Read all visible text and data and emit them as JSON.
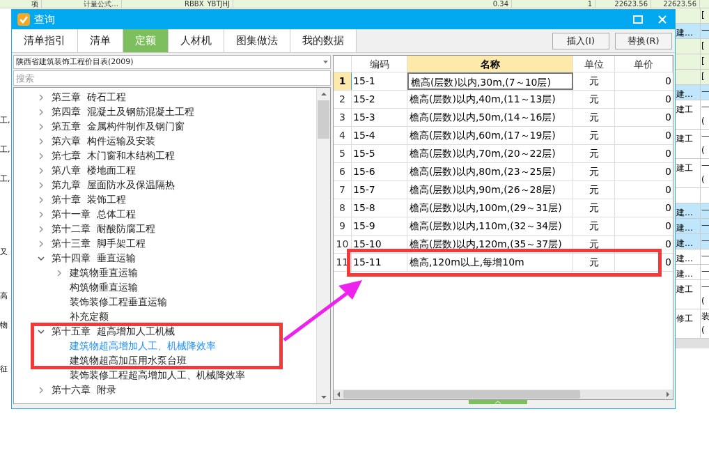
{
  "background": {
    "top_row": [
      "项",
      "计量公式…",
      "RBBX_YBTJHJ",
      "0.34",
      "1",
      "22623.56",
      "22623.56"
    ],
    "left_cells": [
      {},
      {},
      {},
      {},
      {},
      {},
      {},
      {
        "text": "工,"
      },
      {},
      {
        "text": "工,"
      },
      {},
      {
        "text": "工,"
      },
      {},
      {},
      {},
      {},
      {
        "text": "又"
      },
      {},
      {},
      {
        "text": "高"
      },
      {},
      {
        "text": "物"
      },
      {},
      {},
      {
        "text": "征"
      }
    ],
    "right_rows": [
      {
        "kind": "group",
        "column_2": [
          "["
        ]
      },
      {
        "kind": "item",
        "selected": true,
        "column_1": "建…",
        "column_2": [
          "一"
        ]
      },
      {
        "kind": "group",
        "column_2": [
          "["
        ]
      },
      {
        "kind": "group",
        "column_2": [
          "["
        ]
      },
      {
        "kind": "group",
        "column_2": [
          "["
        ]
      },
      {
        "kind": "item",
        "selected": true,
        "column_1": "建…",
        "column_2": [
          "一"
        ]
      },
      {
        "kind": "item",
        "selected": false,
        "column_1": "建工",
        "column_2": [
          "一",
          "("
        ]
      },
      {
        "kind": "item",
        "selected": false,
        "column_1": "建工",
        "column_2": [
          "一",
          "("
        ]
      },
      {
        "kind": "item",
        "selected": false,
        "column_1": "建工",
        "column_2": [
          "一",
          "("
        ]
      },
      {
        "kind": "item",
        "selected": false
      },
      {
        "kind": "item",
        "selected": true,
        "column_1": "建…",
        "column_2": [
          "一"
        ]
      },
      {
        "kind": "item",
        "selected": true,
        "column_1": "建…",
        "column_2": [
          "一"
        ]
      },
      {
        "kind": "item",
        "selected": true,
        "column_1": "建…",
        "column_2": [
          "一"
        ]
      },
      {
        "kind": "item",
        "selected": false,
        "column_1": "建…",
        "column_2": [
          "一"
        ]
      },
      {
        "kind": "item",
        "selected": false,
        "column_1": "建…",
        "column_2": [
          "一"
        ]
      },
      {
        "kind": "item",
        "selected": false,
        "column_1": "建工",
        "column_2": [
          "一",
          "("
        ]
      },
      {
        "kind": "item",
        "selected": false,
        "column_1": "修工",
        "column_2": [
          "装",
          "("
        ]
      }
    ]
  },
  "window": {
    "title": "查询"
  },
  "tabs": [
    {
      "label": "清单指引",
      "selected": false
    },
    {
      "label": "清单",
      "selected": false
    },
    {
      "label": "定额",
      "selected": true
    },
    {
      "label": "人材机",
      "selected": false
    },
    {
      "label": "图集做法",
      "selected": false
    },
    {
      "label": "我的数据",
      "selected": false
    }
  ],
  "buttons": [
    "插入(I)",
    "替换(R)"
  ],
  "library": {
    "value": "陕西省建筑装饰工程价目表(2009)"
  },
  "search": {
    "placeholder": "搜索"
  },
  "tree": [
    {
      "label": "第三章  砖石工程",
      "expanded": false
    },
    {
      "label": "第四章  混凝土及钢筋混凝土工程",
      "expanded": false
    },
    {
      "label": "第五章  金属构件制作及钢门窗",
      "expanded": false
    },
    {
      "label": "第六章  构件运输及安装",
      "expanded": false
    },
    {
      "label": "第七章  木门窗和木结构工程",
      "expanded": false
    },
    {
      "label": "第八章  楼地面工程",
      "expanded": false
    },
    {
      "label": "第九章  屋面防水及保温隔热",
      "expanded": false
    },
    {
      "label": "第十章  装饰工程",
      "expanded": false
    },
    {
      "label": "第十一章  总体工程",
      "expanded": false
    },
    {
      "label": "第十二章  耐酸防腐工程",
      "expanded": false
    },
    {
      "label": "第十三章  脚手架工程",
      "expanded": false
    },
    {
      "label": "第十四章  垂直运输",
      "expanded": true,
      "children": [
        {
          "label": "建筑物垂直运输",
          "expanded": false,
          "selected": false
        },
        {
          "label": "构筑物垂直运输",
          "selected": false
        },
        {
          "label": "装饰装修工程垂直运输",
          "selected": false
        },
        {
          "label": "补充定额",
          "selected": false
        }
      ]
    },
    {
      "label": "第十五章  超高增加人工机械",
      "expanded": true,
      "children": [
        {
          "label": "建筑物超高增加人工、机械降效率",
          "selected": true
        },
        {
          "label": "建筑物超高加压用水泵台班",
          "selected": false
        },
        {
          "label": "装饰装修工程超高增加人工、机械降效率",
          "selected": false
        }
      ]
    },
    {
      "label": "第十六章  附录",
      "expanded": false
    }
  ],
  "table": {
    "columns": [
      "编码",
      "名称",
      "单位",
      "单价"
    ],
    "rows": [
      {
        "number": "1",
        "code": "15-1",
        "name": "檐高(层数)以内,30m,(7～10层)",
        "unit": "元",
        "price": "0",
        "selected": true
      },
      {
        "number": "2",
        "code": "15-2",
        "name": "檐高(层数)以内,40m,(11～13层)",
        "unit": "元",
        "price": "0",
        "selected": false
      },
      {
        "number": "3",
        "code": "15-3",
        "name": "檐高(层数)以内,50m,(14～16层)",
        "unit": "元",
        "price": "0",
        "selected": false
      },
      {
        "number": "4",
        "code": "15-4",
        "name": "檐高(层数)以内,60m,(17～19层)",
        "unit": "元",
        "price": "0",
        "selected": false
      },
      {
        "number": "5",
        "code": "15-5",
        "name": "檐高(层数)以内,70m,(20～22层)",
        "unit": "元",
        "price": "0",
        "selected": false
      },
      {
        "number": "6",
        "code": "15-6",
        "name": "檐高(层数)以内,80m,(23～25层)",
        "unit": "元",
        "price": "0",
        "selected": false
      },
      {
        "number": "7",
        "code": "15-7",
        "name": "檐高(层数)以内,90m,(26～28层)",
        "unit": "元",
        "price": "0",
        "selected": false
      },
      {
        "number": "8",
        "code": "15-8",
        "name": "檐高(层数)以内,100m,(29～31层)",
        "unit": "元",
        "price": "0",
        "selected": false
      },
      {
        "number": "9",
        "code": "15-9",
        "name": "檐高(层数)以内,110m,(32～34层)",
        "unit": "元",
        "price": "0",
        "selected": false
      },
      {
        "number": "10",
        "code": "15-10",
        "name": "檐高(层数)以内,120m,(35～37层)",
        "unit": "元",
        "price": "0",
        "selected": false
      },
      {
        "number": "11",
        "code": "15-11",
        "name": "檐高,120m以上,每增10m",
        "unit": "元",
        "price": "0",
        "selected": false
      }
    ]
  }
}
